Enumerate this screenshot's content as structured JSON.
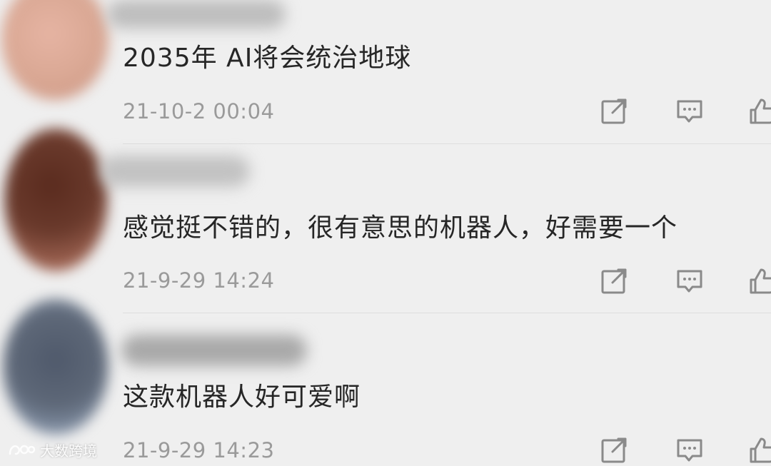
{
  "comments": [
    {
      "text": "2035年 AI将会统治地球",
      "time": "21-10-2 00:04",
      "avatar_color": "#d9a793",
      "username_blur_color": "#bdbdbd"
    },
    {
      "text": "感觉挺不错的，很有意思的机器人，好需要一个",
      "time": "21-9-29 14:24",
      "avatar_color": "#6a3a2c",
      "username_blur_color": "#c2c2c2"
    },
    {
      "text": "这款机器人好可爱啊",
      "time": "21-9-29 14:23",
      "avatar_color": "#5e6878",
      "username_blur_color": "#a9a9a9"
    }
  ],
  "icons": {
    "share": "share-icon",
    "reply": "reply-icon",
    "like": "like-icon"
  },
  "watermark": {
    "text": "大数跨境"
  },
  "colors": {
    "background": "#efefef",
    "text": "#262626",
    "timestamp": "#9a9a9a",
    "icon": "#8a8a8a"
  }
}
